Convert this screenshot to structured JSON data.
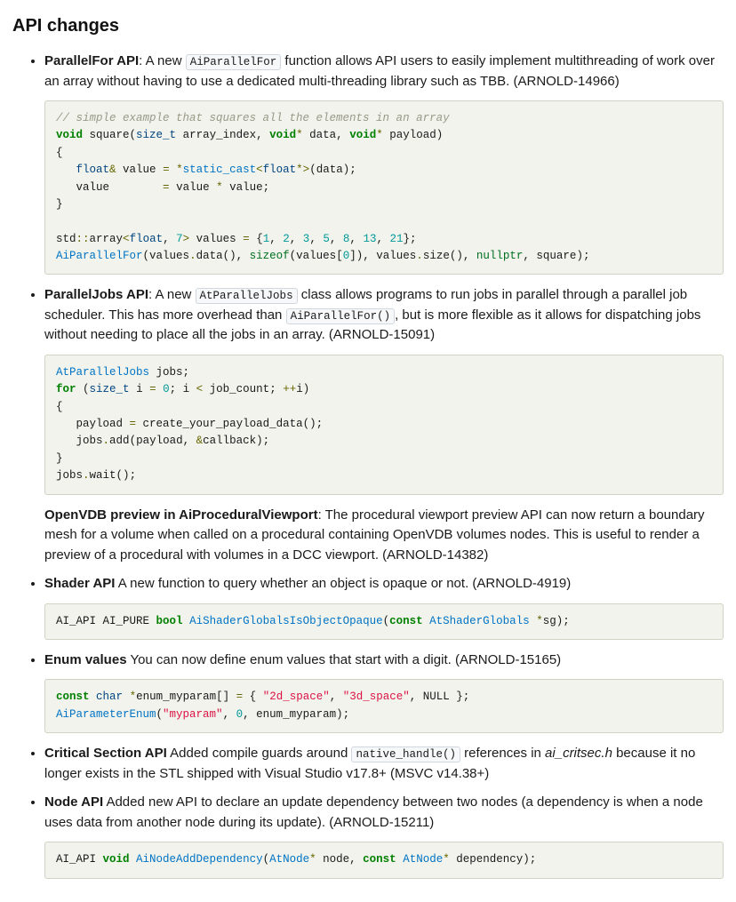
{
  "heading": "API changes",
  "items": [
    {
      "title": "ParallelFor API",
      "lead": ": A new ",
      "code_inline": "AiParallelFor",
      "rest": " function allows API users to easily implement multithreading of work over an array without having to use a dedicated multi-threading library such as TBB. (ARNOLD-14966)"
    },
    {
      "title": "ParallelJobs API",
      "lead": ": A new ",
      "code_inline": "AtParallelJobs",
      "rest1": " class allows programs to run jobs in parallel through a parallel job scheduler. This has more overhead than ",
      "code_inline2": "AiParallelFor()",
      "rest2": ", but is more flexible as it allows for dispatching jobs without needing to place all the jobs in an array. (ARNOLD-15091)"
    },
    {
      "title": "OpenVDB preview in AiProceduralViewport",
      "rest": ": The procedural viewport preview API can now return a boundary mesh for a volume when called on a procedural containing OpenVDB volumes nodes. This is useful to render a preview of a procedural with volumes in a DCC viewport. (ARNOLD-14382)"
    },
    {
      "title": "Shader API",
      "rest": " A new function to query whether an object is opaque or not. (ARNOLD-4919)"
    },
    {
      "title": "Enum values",
      "rest": " You can now define enum values that start with a digit. (ARNOLD-15165)"
    },
    {
      "title": "Critical Section API",
      "rest1": " Added compile guards around ",
      "code_inline": "native_handle()",
      "rest2": " references in ",
      "em": "ai_critsec.h",
      "rest3": " because it no longer exists in the STL shipped with Visual Studio v17.8+ (MSVC v14.38+)"
    },
    {
      "title": "Node API",
      "rest": " Added new API to declare an update dependency between two nodes (a dependency is when a node uses data from another node during its update). (ARNOLD-15211)"
    }
  ],
  "code1": {
    "l1": "// simple example that squares all the elements in an array",
    "l2_void": "void",
    "l2_square": " square",
    "l2_p1": "(",
    "l2_size_t": "size_t",
    "l2_ai": " array_index",
    "l2_c1": ",",
    "l2_sp1": " ",
    "l2_void2": "void",
    "l2_star1": "*",
    "l2_data": " data",
    "l2_c2": ",",
    "l2_sp2": " ",
    "l2_void3": "void",
    "l2_star2": "*",
    "l2_payload": " payload",
    "l2_p2": ")",
    "l3": "{",
    "l4_pad": "   ",
    "l4_float": "float",
    "l4_amp": "&",
    "l4_value": " value ",
    "l4_eq": "=",
    "l4_sp": " ",
    "l4_star": "*",
    "l4_sc": "static_cast",
    "l4_lt": "<",
    "l4_float2": "float",
    "l4_star2": "*",
    "l4_gt": ">",
    "l4_p1": "(",
    "l4_data": "data",
    "l4_p2": ")",
    "l4_semi": ";",
    "l5_pad": "   ",
    "l5_v1": "value        ",
    "l5_eq": "=",
    "l5_sp": " value ",
    "l5_star": "*",
    "l5_v2": " value",
    "l5_semi": ";",
    "l6": "}",
    "l8_std": "std",
    "l8_cc": "::",
    "l8_array": "array",
    "l8_lt": "<",
    "l8_float": "float",
    "l8_c": ",",
    "l8_sp": " ",
    "l8_7": "7",
    "l8_gt": ">",
    "l8_values": " values ",
    "l8_eq": "=",
    "l8_sp2": " ",
    "l8_lb": "{",
    "l8_n1": "1",
    "l8_c1": ",",
    "l8_s1": " ",
    "l8_n2": "2",
    "l8_c2": ",",
    "l8_s2": " ",
    "l8_n3": "3",
    "l8_c3": ",",
    "l8_s3": " ",
    "l8_n4": "5",
    "l8_c4": ",",
    "l8_s4": " ",
    "l8_n5": "8",
    "l8_c5": ",",
    "l8_s5": " ",
    "l8_n6": "13",
    "l8_c6": ",",
    "l8_s6": " ",
    "l8_n7": "21",
    "l8_rb": "}",
    "l8_semi": ";",
    "l9_fn": "AiParallelFor",
    "l9_p1": "(",
    "l9_values": "values",
    "l9_dot": ".",
    "l9_data": "data",
    "l9_pp": "()",
    "l9_c1": ",",
    "l9_sp1": " ",
    "l9_sizeof": "sizeof",
    "l9_p2": "(",
    "l9_values2": "values",
    "l9_lb": "[",
    "l9_0": "0",
    "l9_rb": "]",
    "l9_p3": ")",
    "l9_c2": ",",
    "l9_sp2": " ",
    "l9_values3": "values",
    "l9_dot2": ".",
    "l9_size": "size",
    "l9_pp2": "()",
    "l9_c3": ",",
    "l9_sp3": " ",
    "l9_nullptr": "nullptr",
    "l9_c4": ",",
    "l9_sp4": " ",
    "l9_square": "square",
    "l9_p4": ")",
    "l9_semi": ";"
  },
  "code2": {
    "l1_at": "AtParallelJobs",
    "l1_jobs": " jobs",
    "l1_semi": ";",
    "l2_for": "for",
    "l2_sp": " ",
    "l2_p1": "(",
    "l2_size_t": "size_t",
    "l2_i": " i ",
    "l2_eq": "=",
    "l2_sp2": " ",
    "l2_0": "0",
    "l2_semi": ";",
    "l2_sp3": " i ",
    "l2_lt": "<",
    "l2_jc": " job_count",
    "l2_semi2": ";",
    "l2_sp4": " ",
    "l2_pp": "++",
    "l2_i2": "i",
    "l2_p2": ")",
    "l3": "{",
    "l4_pad": "   ",
    "l4_pl": "payload ",
    "l4_eq": "=",
    "l4_fn": " create_your_payload_data",
    "l4_pp": "()",
    "l4_semi": ";",
    "l5_pad": "   ",
    "l5_jobs": "jobs",
    "l5_dot": ".",
    "l5_add": "add",
    "l5_p1": "(",
    "l5_pl": "payload",
    "l5_c": ",",
    "l5_sp": " ",
    "l5_amp": "&",
    "l5_cb": "callback",
    "l5_p2": ")",
    "l5_semi": ";",
    "l6": "}",
    "l7_jobs": "jobs",
    "l7_dot": ".",
    "l7_wait": "wait",
    "l7_pp": "()",
    "l7_semi": ";"
  },
  "code3": {
    "l1_api": "AI_API AI_PURE ",
    "l1_bool": "bool",
    "l1_sp": " ",
    "l1_fn": "AiShaderGlobalsIsObjectOpaque",
    "l1_p1": "(",
    "l1_const": "const",
    "l1_sp2": " ",
    "l1_sg": "AtShaderGlobals",
    "l1_sp3": " ",
    "l1_star": "*",
    "l1_sgv": "sg",
    "l1_p2": ")",
    "l1_semi": ";"
  },
  "code4": {
    "l1_const": "const",
    "l1_sp": " ",
    "l1_char": "char",
    "l1_sp2": " ",
    "l1_star": "*",
    "l1_id": "enum_myparam",
    "l1_br": "[]",
    "l1_sp3": " ",
    "l1_eq": "=",
    "l1_sp4": " ",
    "l1_lb": "{",
    "l1_sp5": " ",
    "l1_s1": "\"2d_space\"",
    "l1_c1": ",",
    "l1_sp6": " ",
    "l1_s2": "\"3d_space\"",
    "l1_c2": ",",
    "l1_sp7": " NULL ",
    "l1_rb": "}",
    "l1_semi": ";",
    "l2_fn": "AiParameterEnum",
    "l2_p1": "(",
    "l2_s": "\"myparam\"",
    "l2_c1": ",",
    "l2_sp": " ",
    "l2_0": "0",
    "l2_c2": ",",
    "l2_sp2": " enum_myparam",
    "l2_p2": ")",
    "l2_semi": ";"
  },
  "code5": {
    "l1_api": "AI_API ",
    "l1_void": "void",
    "l1_sp": " ",
    "l1_fn": "AiNodeAddDependency",
    "l1_p1": "(",
    "l1_at": "AtNode",
    "l1_star": "*",
    "l1_node": " node",
    "l1_c": ",",
    "l1_sp2": " ",
    "l1_const": "const",
    "l1_sp3": " ",
    "l1_at2": "AtNode",
    "l1_star2": "*",
    "l1_dep": " dependency",
    "l1_p2": ")",
    "l1_semi": ";"
  }
}
